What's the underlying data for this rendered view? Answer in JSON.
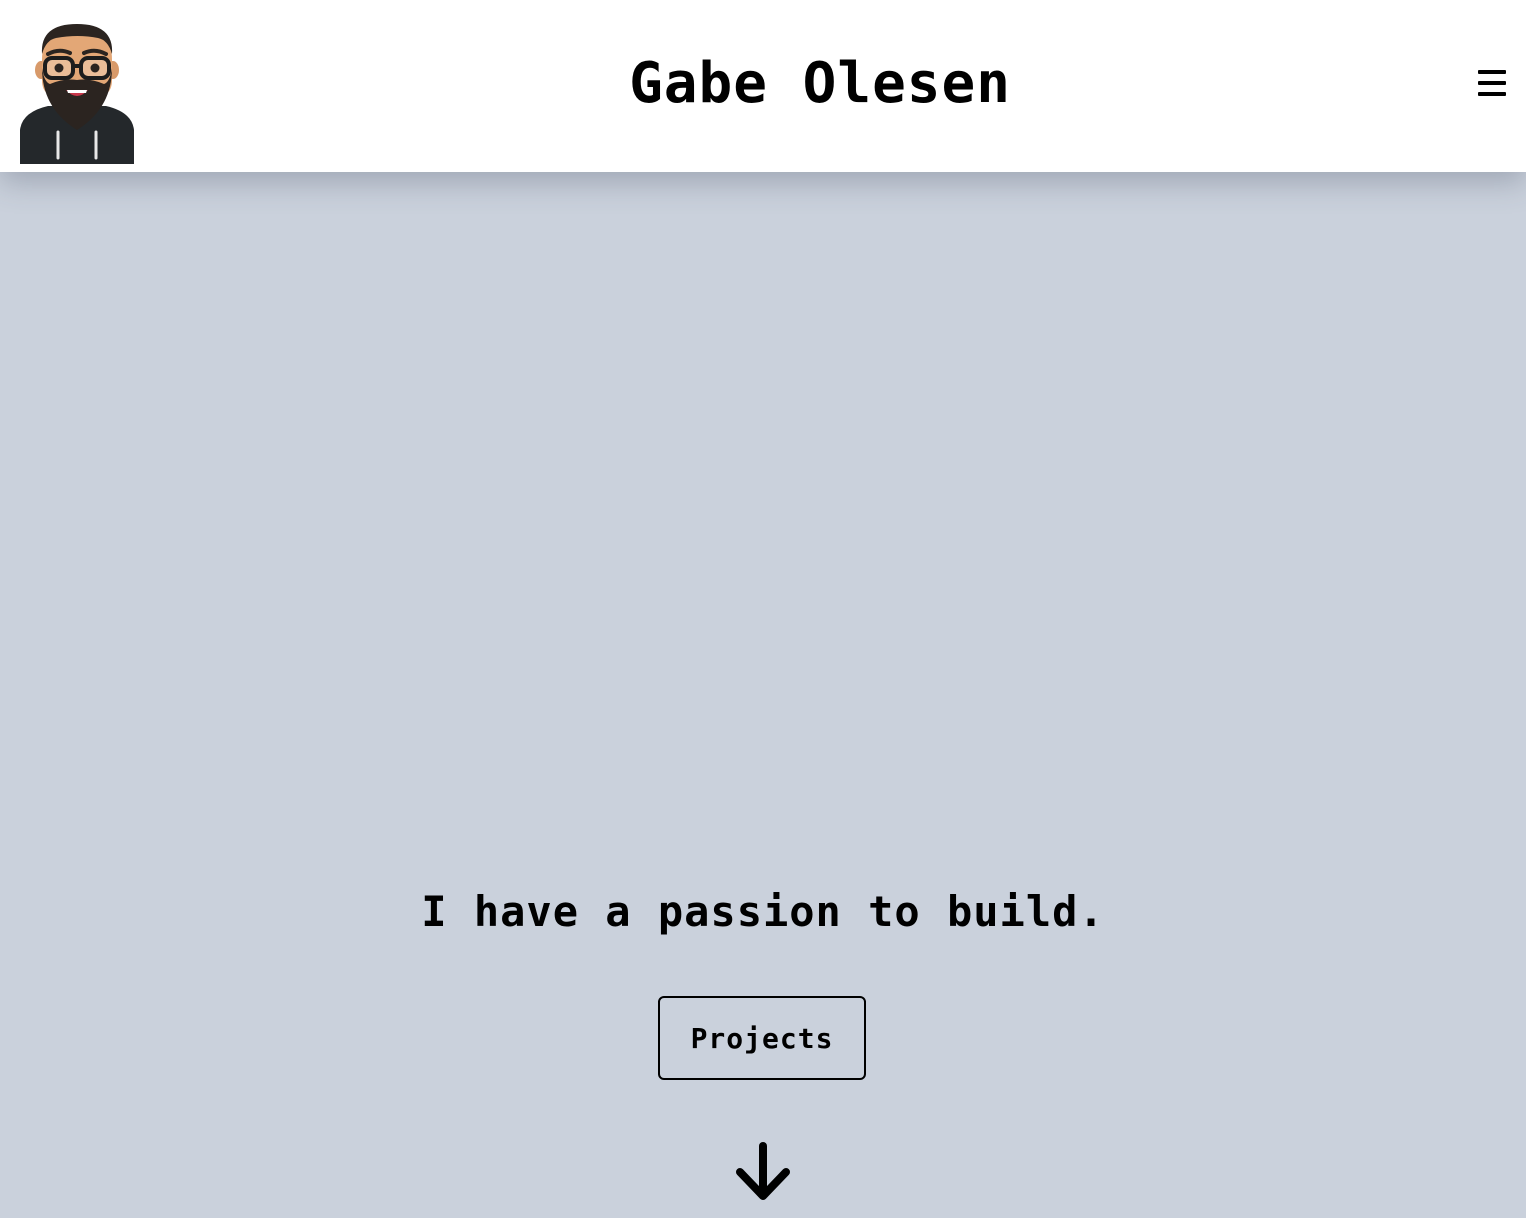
{
  "header": {
    "site_title": "Gabe Olesen",
    "avatar_icon": "bearded-man-avatar-icon",
    "menu_icon": "hamburger-menu-icon"
  },
  "hero": {
    "tagline": "I have a passion to build.",
    "projects_button_label": "Projects",
    "scroll_icon": "arrow-down-icon"
  },
  "colors": {
    "header_bg": "#ffffff",
    "hero_bg": "#cad1dc",
    "text": "#000000"
  }
}
